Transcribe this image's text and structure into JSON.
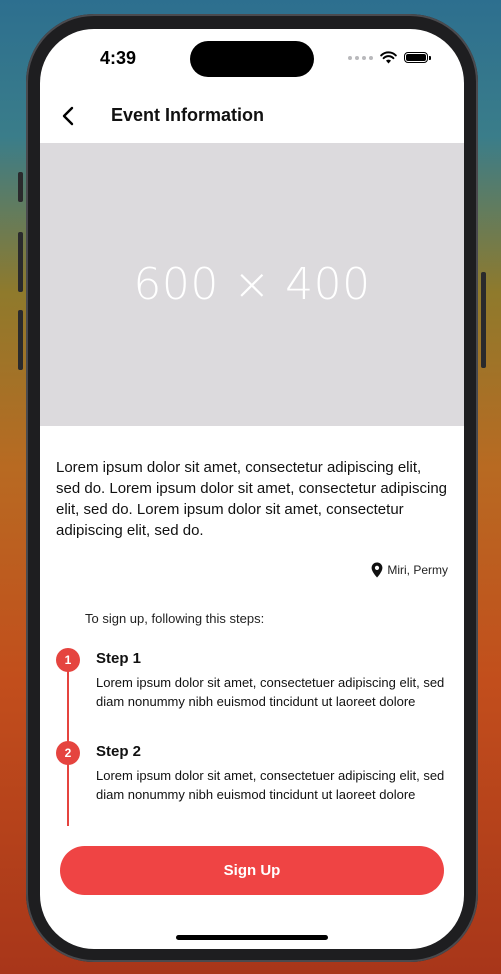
{
  "status_bar": {
    "time": "4:39"
  },
  "header": {
    "title": "Event Information",
    "back_icon": "chevron-left-icon"
  },
  "hero_image": {
    "placeholder_text": "600 × 400"
  },
  "event": {
    "description": "Lorem ipsum dolor sit amet, consectetur adipiscing elit, sed do. Lorem ipsum dolor sit amet, consectetur adipiscing elit, sed do. Lorem ipsum dolor sit amet, consectetur adipiscing elit, sed do.",
    "location": "Miri, Permy",
    "location_icon": "map-pin-icon"
  },
  "steps": {
    "intro": "To sign up, following this steps:",
    "items": [
      {
        "number": "1",
        "title": "Step 1",
        "body": "Lorem ipsum dolor sit amet, consectetuer adipiscing elit, sed diam nonummy nibh euismod tincidunt ut laoreet dolore"
      },
      {
        "number": "2",
        "title": "Step 2",
        "body": "Lorem ipsum dolor sit amet, consectetuer adipiscing elit, sed diam nonummy nibh euismod tincidunt ut laoreet dolore"
      }
    ]
  },
  "actions": {
    "signup_label": "Sign Up"
  },
  "colors": {
    "accent": "#ef4444",
    "timeline": "#e5443f",
    "hero_bg": "#dcdadd"
  }
}
